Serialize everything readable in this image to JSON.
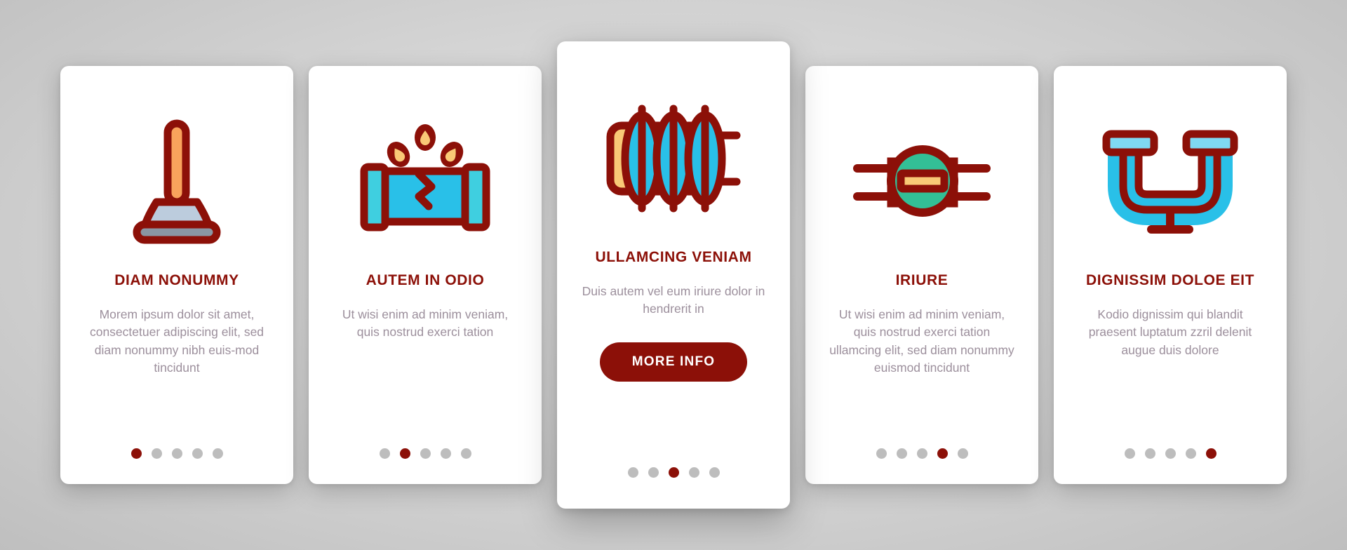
{
  "theme": {
    "accent": "#8c1008",
    "body_text": "#9c8f9c",
    "dot_inactive": "#bdbdbd",
    "card_bg": "#ffffff",
    "page_bg": "#d9d9d9",
    "icon_cyan": "#29c0e8",
    "icon_orange": "#f9a35c",
    "icon_yellow": "#f9c976",
    "icon_green": "#33bf96",
    "icon_gray": "#8a96a3",
    "icon_lightblue": "#bcccdd"
  },
  "cards": [
    {
      "icon": "plunger-icon",
      "title": "DIAM NONUMMY",
      "body": "Morem ipsum dolor sit amet, consectetuer adipiscing elit, sed diam nonummy nibh euis-mod tincidunt",
      "button": null,
      "dots": {
        "count": 5,
        "active": 0
      }
    },
    {
      "icon": "broken-pipe-leak-icon",
      "title": "AUTEM IN ODIO",
      "body": "Ut wisi enim ad minim veniam, quis nostrud exerci tation",
      "button": null,
      "dots": {
        "count": 5,
        "active": 1
      }
    },
    {
      "icon": "radiator-icon",
      "title": "ULLAMCING VENIAM",
      "body": "Duis autem vel eum iriure dolor in hendrerit in",
      "button": "MORE INFO",
      "dots": {
        "count": 5,
        "active": 2
      }
    },
    {
      "icon": "pipe-valve-icon",
      "title": "IRIURE",
      "body": "Ut wisi enim ad minim veniam, quis nostrud exerci tation ullamcing elit, sed diam nonummy euismod tincidunt",
      "button": null,
      "dots": {
        "count": 5,
        "active": 3
      }
    },
    {
      "icon": "u-trap-pipe-icon",
      "title": "DIGNISSIM DOLOE EIT",
      "body": "Kodio dignissim qui blandit praesent luptatum zzril delenit augue duis dolore",
      "button": null,
      "dots": {
        "count": 5,
        "active": 4
      }
    }
  ]
}
